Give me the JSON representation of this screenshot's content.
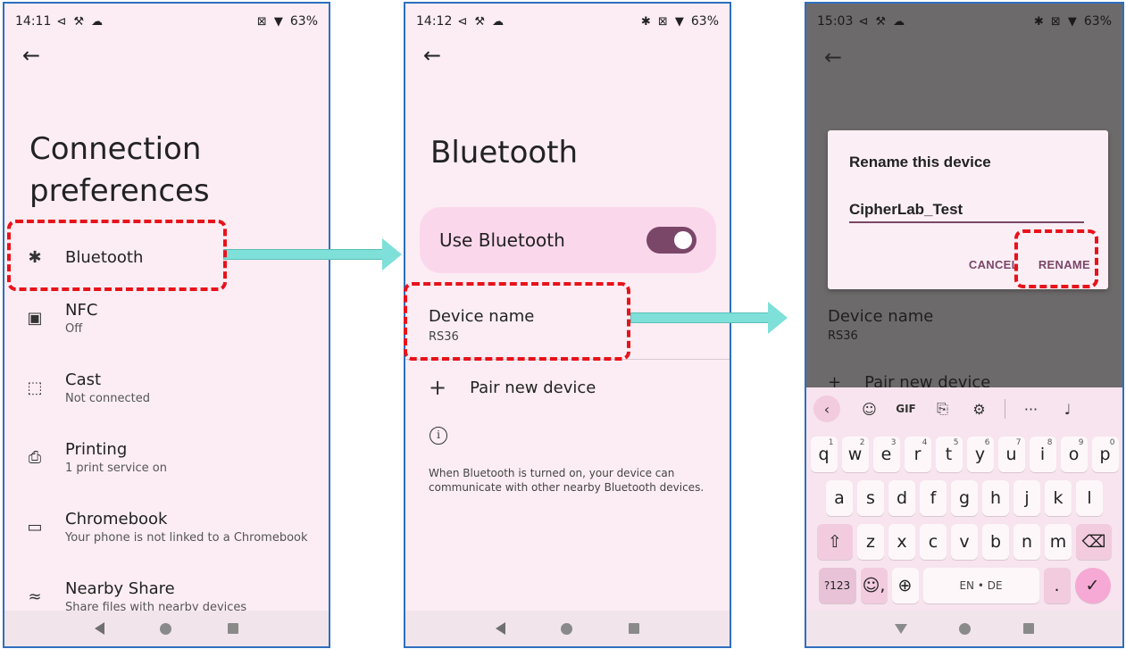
{
  "colors": {
    "frame_border": "#2e6fbf",
    "highlight": "#e8121b",
    "arrow": "#7ee0d9",
    "accent": "#7a4769",
    "screen_bg": "#fbedf3"
  },
  "screen1": {
    "status": {
      "time": "14:11",
      "left_icons": "⊲ ⚒ ☁",
      "right_icons": "⊠ ▼",
      "battery": "63%"
    },
    "title_line1": "Connection",
    "title_line2": "preferences",
    "items": [
      {
        "icon": "bluetooth-icon",
        "glyph": "✱",
        "title": "Bluetooth",
        "subtitle": ""
      },
      {
        "icon": "nfc-icon",
        "glyph": "▣",
        "title": "NFC",
        "subtitle": "Off"
      },
      {
        "icon": "cast-icon",
        "glyph": "⬚",
        "title": "Cast",
        "subtitle": "Not connected"
      },
      {
        "icon": "print-icon",
        "glyph": "⎙",
        "title": "Printing",
        "subtitle": "1 print service on"
      },
      {
        "icon": "chromebook-icon",
        "glyph": "▭",
        "title": "Chromebook",
        "subtitle": "Your phone is not linked to a Chromebook"
      },
      {
        "icon": "nearby-share-icon",
        "glyph": "≈",
        "title": "Nearby Share",
        "subtitle": "Share files with nearby devices"
      }
    ]
  },
  "screen2": {
    "status": {
      "time": "14:12",
      "left_icons": "⊲ ⚒ ☁",
      "right_icons": "✱ ⊠ ▼",
      "battery": "63%"
    },
    "title": "Bluetooth",
    "use_bluetooth_label": "Use Bluetooth",
    "use_bluetooth_on": true,
    "device_name_label": "Device name",
    "device_name_value": "RS36",
    "pair_label": "Pair new device",
    "info_text": "When Bluetooth is turned on, your device can communicate with other nearby Bluetooth devices."
  },
  "screen3": {
    "status": {
      "time": "15:03",
      "left_icons": "⊲ ⚒ ☁",
      "right_icons": "✱ ⊠ ▼",
      "battery": "63%"
    },
    "dialog_title": "Rename this device",
    "dialog_value": "CipherLab_Test",
    "cancel_label": "CANCEL",
    "rename_label": "RENAME",
    "bg_device_name_label": "Device name",
    "bg_device_name_value": "RS36",
    "bg_pair_label": "Pair new device",
    "keyboard": {
      "toolbar": {
        "collapse": "‹",
        "sticker": "☺",
        "gif": "GIF",
        "clipboard": "⎘",
        "settings": "⚙",
        "more": "···",
        "mic": "♩"
      },
      "row1": [
        "q",
        "w",
        "e",
        "r",
        "t",
        "y",
        "u",
        "i",
        "o",
        "p"
      ],
      "row1_hints": [
        "1",
        "2",
        "3",
        "4",
        "5",
        "6",
        "7",
        "8",
        "9",
        "0"
      ],
      "row2": [
        "a",
        "s",
        "d",
        "f",
        "g",
        "h",
        "j",
        "k",
        "l"
      ],
      "row3": [
        "z",
        "x",
        "c",
        "v",
        "b",
        "n",
        "m"
      ],
      "shift": "⇧",
      "backspace": "⌫",
      "symbols": "?123",
      "emoji_comma": "☺,",
      "globe": "⊕",
      "space": "EN • DE",
      "period": ".",
      "enter": "✓"
    }
  }
}
